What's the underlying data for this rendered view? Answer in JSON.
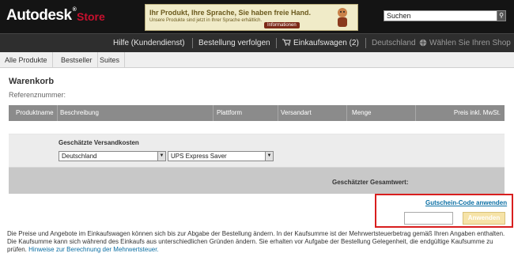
{
  "header": {
    "brand": "Autodesk",
    "trademark": "®",
    "store": "Store",
    "banner": {
      "line1": "Ihr Produkt, Ihre Sprache, Sie haben freie Hand.",
      "line2": "Unsere Produkte sind jetzt in Ihrer Sprache erhältlich.",
      "button": "Informationen"
    },
    "search": {
      "value": "Suchen",
      "button_icon": "search-icon"
    }
  },
  "nav": {
    "help": "Hilfe (Kundendienst)",
    "track": "Bestellung verfolgen",
    "cart_icon": "cart-icon",
    "cart": "Einkaufswagen (2)",
    "country": "Deutschland",
    "globe_icon": "globe-icon",
    "choose_shop": "Wählen Sie Ihren Shop"
  },
  "tabs": [
    "Alle Produkte",
    "Bestseller",
    "Suites"
  ],
  "cart": {
    "title": "Warenkorb",
    "reference_label": "Referenznummer:",
    "columns": [
      "Produktname",
      "Beschreibung",
      "Plattform",
      "Versandart",
      "Menge",
      "Preis inkl. MwSt."
    ],
    "shipping_label": "Geschätzte Versandkosten",
    "country_select": "Deutschland",
    "method_select": "UPS Express Saver",
    "total_label": "Geschätzter Gesamtwert:"
  },
  "coupon": {
    "link": "Gutschein-Code anwenden",
    "input_value": "",
    "apply_button": "Anwenden"
  },
  "footer": {
    "text": "Die Preise und Angebote im Einkaufswagen können sich bis zur Abgabe der Bestellung ändern. In der Kaufsumme ist der Mehrwertsteuerbetrag gemäß Ihren Angaben enthalten. Die Kaufsumme kann sich während des Einkaufs aus unterschiedlichen Gründen ändern. Sie erhalten vor Aufgabe der Bestellung Gelegenheit, die endgültige Kaufsumme zu prüfen.",
    "link": "Hinweise zur Berechnung der Mehrwertsteuer."
  },
  "colors": {
    "header_bg": "#141414",
    "nav_bg": "#2e2e2e",
    "store_red": "#c8102e",
    "link_blue": "#0b6fa4",
    "highlight_border": "#d81e1e"
  }
}
